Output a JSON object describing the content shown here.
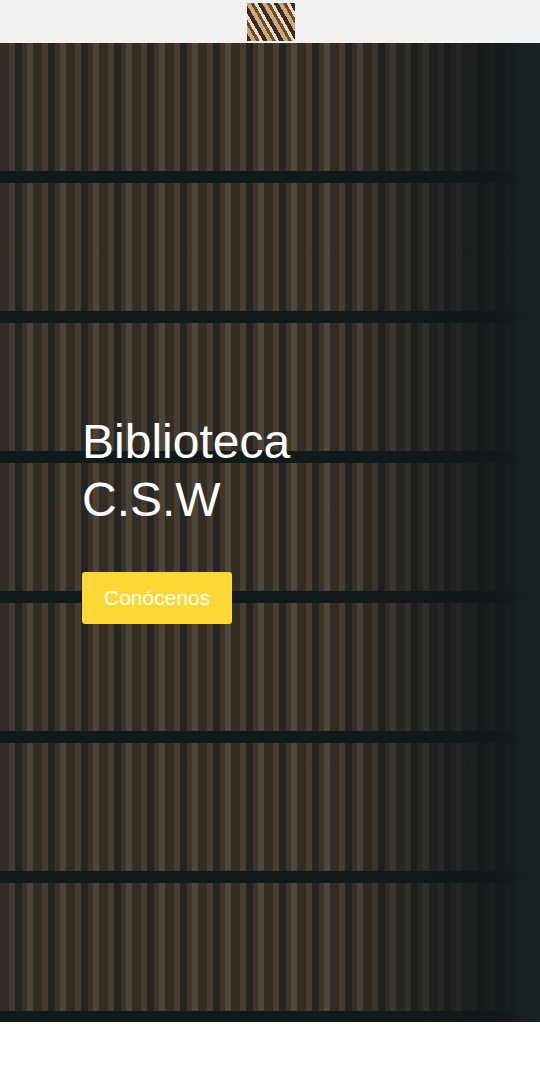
{
  "hero": {
    "title": "Biblioteca C.S.W",
    "button": "Conócenos"
  }
}
